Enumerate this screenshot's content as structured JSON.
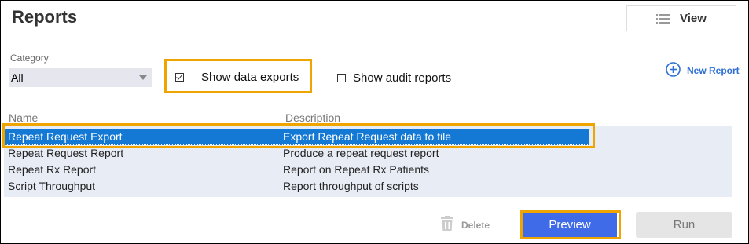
{
  "header": {
    "title": "Reports",
    "view_label": "View"
  },
  "category": {
    "label": "Category",
    "value": "All"
  },
  "filters": {
    "show_data_exports": "Show data exports",
    "show_audit_reports": "Show audit reports"
  },
  "new_report_label": "New Report",
  "columns": {
    "name": "Name",
    "description": "Description"
  },
  "reports": [
    {
      "name": "Repeat Request Export",
      "description": "Export Repeat Request data to file"
    },
    {
      "name": "Repeat Request Report",
      "description": "Produce a repeat request report"
    },
    {
      "name": "Repeat Rx Report",
      "description": "Report on Repeat Rx Patients"
    },
    {
      "name": "Script Throughput",
      "description": "Report throughput of scripts"
    }
  ],
  "actions": {
    "delete": "Delete",
    "preview": "Preview",
    "run": "Run"
  },
  "colors": {
    "accent": "#2e6fd6",
    "highlight": "#f0a400",
    "selected_row": "#1479d4",
    "preview": "#3f6be8"
  }
}
